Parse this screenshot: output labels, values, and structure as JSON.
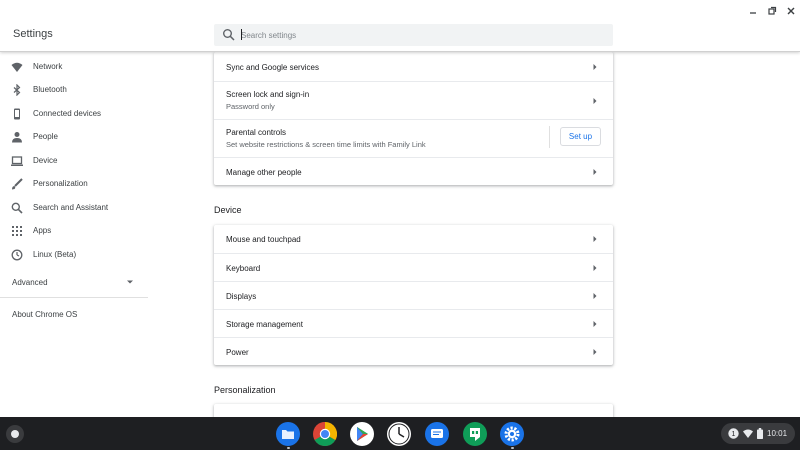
{
  "header": {
    "app_title": "Settings",
    "search_placeholder": "Search settings",
    "window_controls": [
      "minimize-icon",
      "maximize-icon",
      "close-icon"
    ]
  },
  "sidebar": {
    "items": [
      {
        "label": "Network",
        "icon": "wifi-icon"
      },
      {
        "label": "Bluetooth",
        "icon": "bluetooth-icon"
      },
      {
        "label": "Connected devices",
        "icon": "phone-icon"
      },
      {
        "label": "People",
        "icon": "person-icon"
      },
      {
        "label": "Device",
        "icon": "laptop-icon"
      },
      {
        "label": "Personalization",
        "icon": "brush-icon"
      },
      {
        "label": "Search and Assistant",
        "icon": "search-icon"
      },
      {
        "label": "Apps",
        "icon": "apps-grid-icon"
      },
      {
        "label": "Linux (Beta)",
        "icon": "linux-icon"
      }
    ],
    "advanced_label": "Advanced",
    "about_label": "About Chrome OS"
  },
  "people_card": {
    "rows": [
      {
        "title": "Sync and Google services"
      },
      {
        "title": "Screen lock and sign-in",
        "subtitle": "Password only"
      },
      {
        "title": "Parental controls",
        "subtitle": "Set website restrictions & screen time limits with Family Link",
        "button": "Set up"
      },
      {
        "title": "Manage other people"
      }
    ]
  },
  "device_section": {
    "title": "Device",
    "rows": [
      {
        "title": "Mouse and touchpad"
      },
      {
        "title": "Keyboard"
      },
      {
        "title": "Displays"
      },
      {
        "title": "Storage management"
      },
      {
        "title": "Power"
      }
    ]
  },
  "personalization_section": {
    "title": "Personalization"
  },
  "shelf": {
    "apps": [
      "files-icon",
      "chrome-icon",
      "play-store-icon",
      "clock-icon",
      "messages-icon",
      "hangouts-icon",
      "settings-icon"
    ],
    "tray": {
      "time": "10:01",
      "icons": [
        "notification-icon",
        "wifi-icon",
        "battery-icon"
      ]
    }
  }
}
